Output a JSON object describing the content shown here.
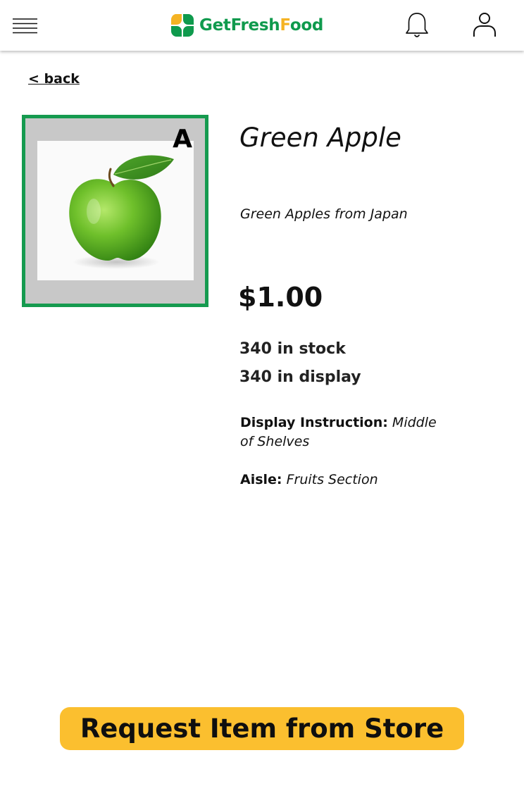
{
  "header": {
    "logo_parts": [
      {
        "text": "Get",
        "color": "#0f9a4d"
      },
      {
        "text": "Fresh",
        "color": "#0f9a4d"
      },
      {
        "text": "F",
        "color": "#f5b323"
      },
      {
        "text": "ood",
        "color": "#0f9a4d"
      }
    ],
    "menu_icon": "hamburger-menu-icon",
    "notification_icon": "bell-icon",
    "profile_icon": "user-icon"
  },
  "nav": {
    "back_label": "< back"
  },
  "product": {
    "grade": "A",
    "name": "Green Apple",
    "origin": "Green Apples from Japan",
    "price": "$1.00",
    "stock": "340 in stock",
    "display_count": "340 in display",
    "display_instruction_label": "Display Instruction:",
    "display_instruction_value": "Middle of Shelves",
    "aisle_label": "Aisle:",
    "aisle_value": "Fruits Section"
  },
  "actions": {
    "request_label": "Request Item from Store"
  },
  "colors": {
    "brand_green": "#0f9a4d",
    "brand_yellow": "#f5b323",
    "card_border": "#159a4f",
    "button_bg": "#fbbf2f"
  }
}
